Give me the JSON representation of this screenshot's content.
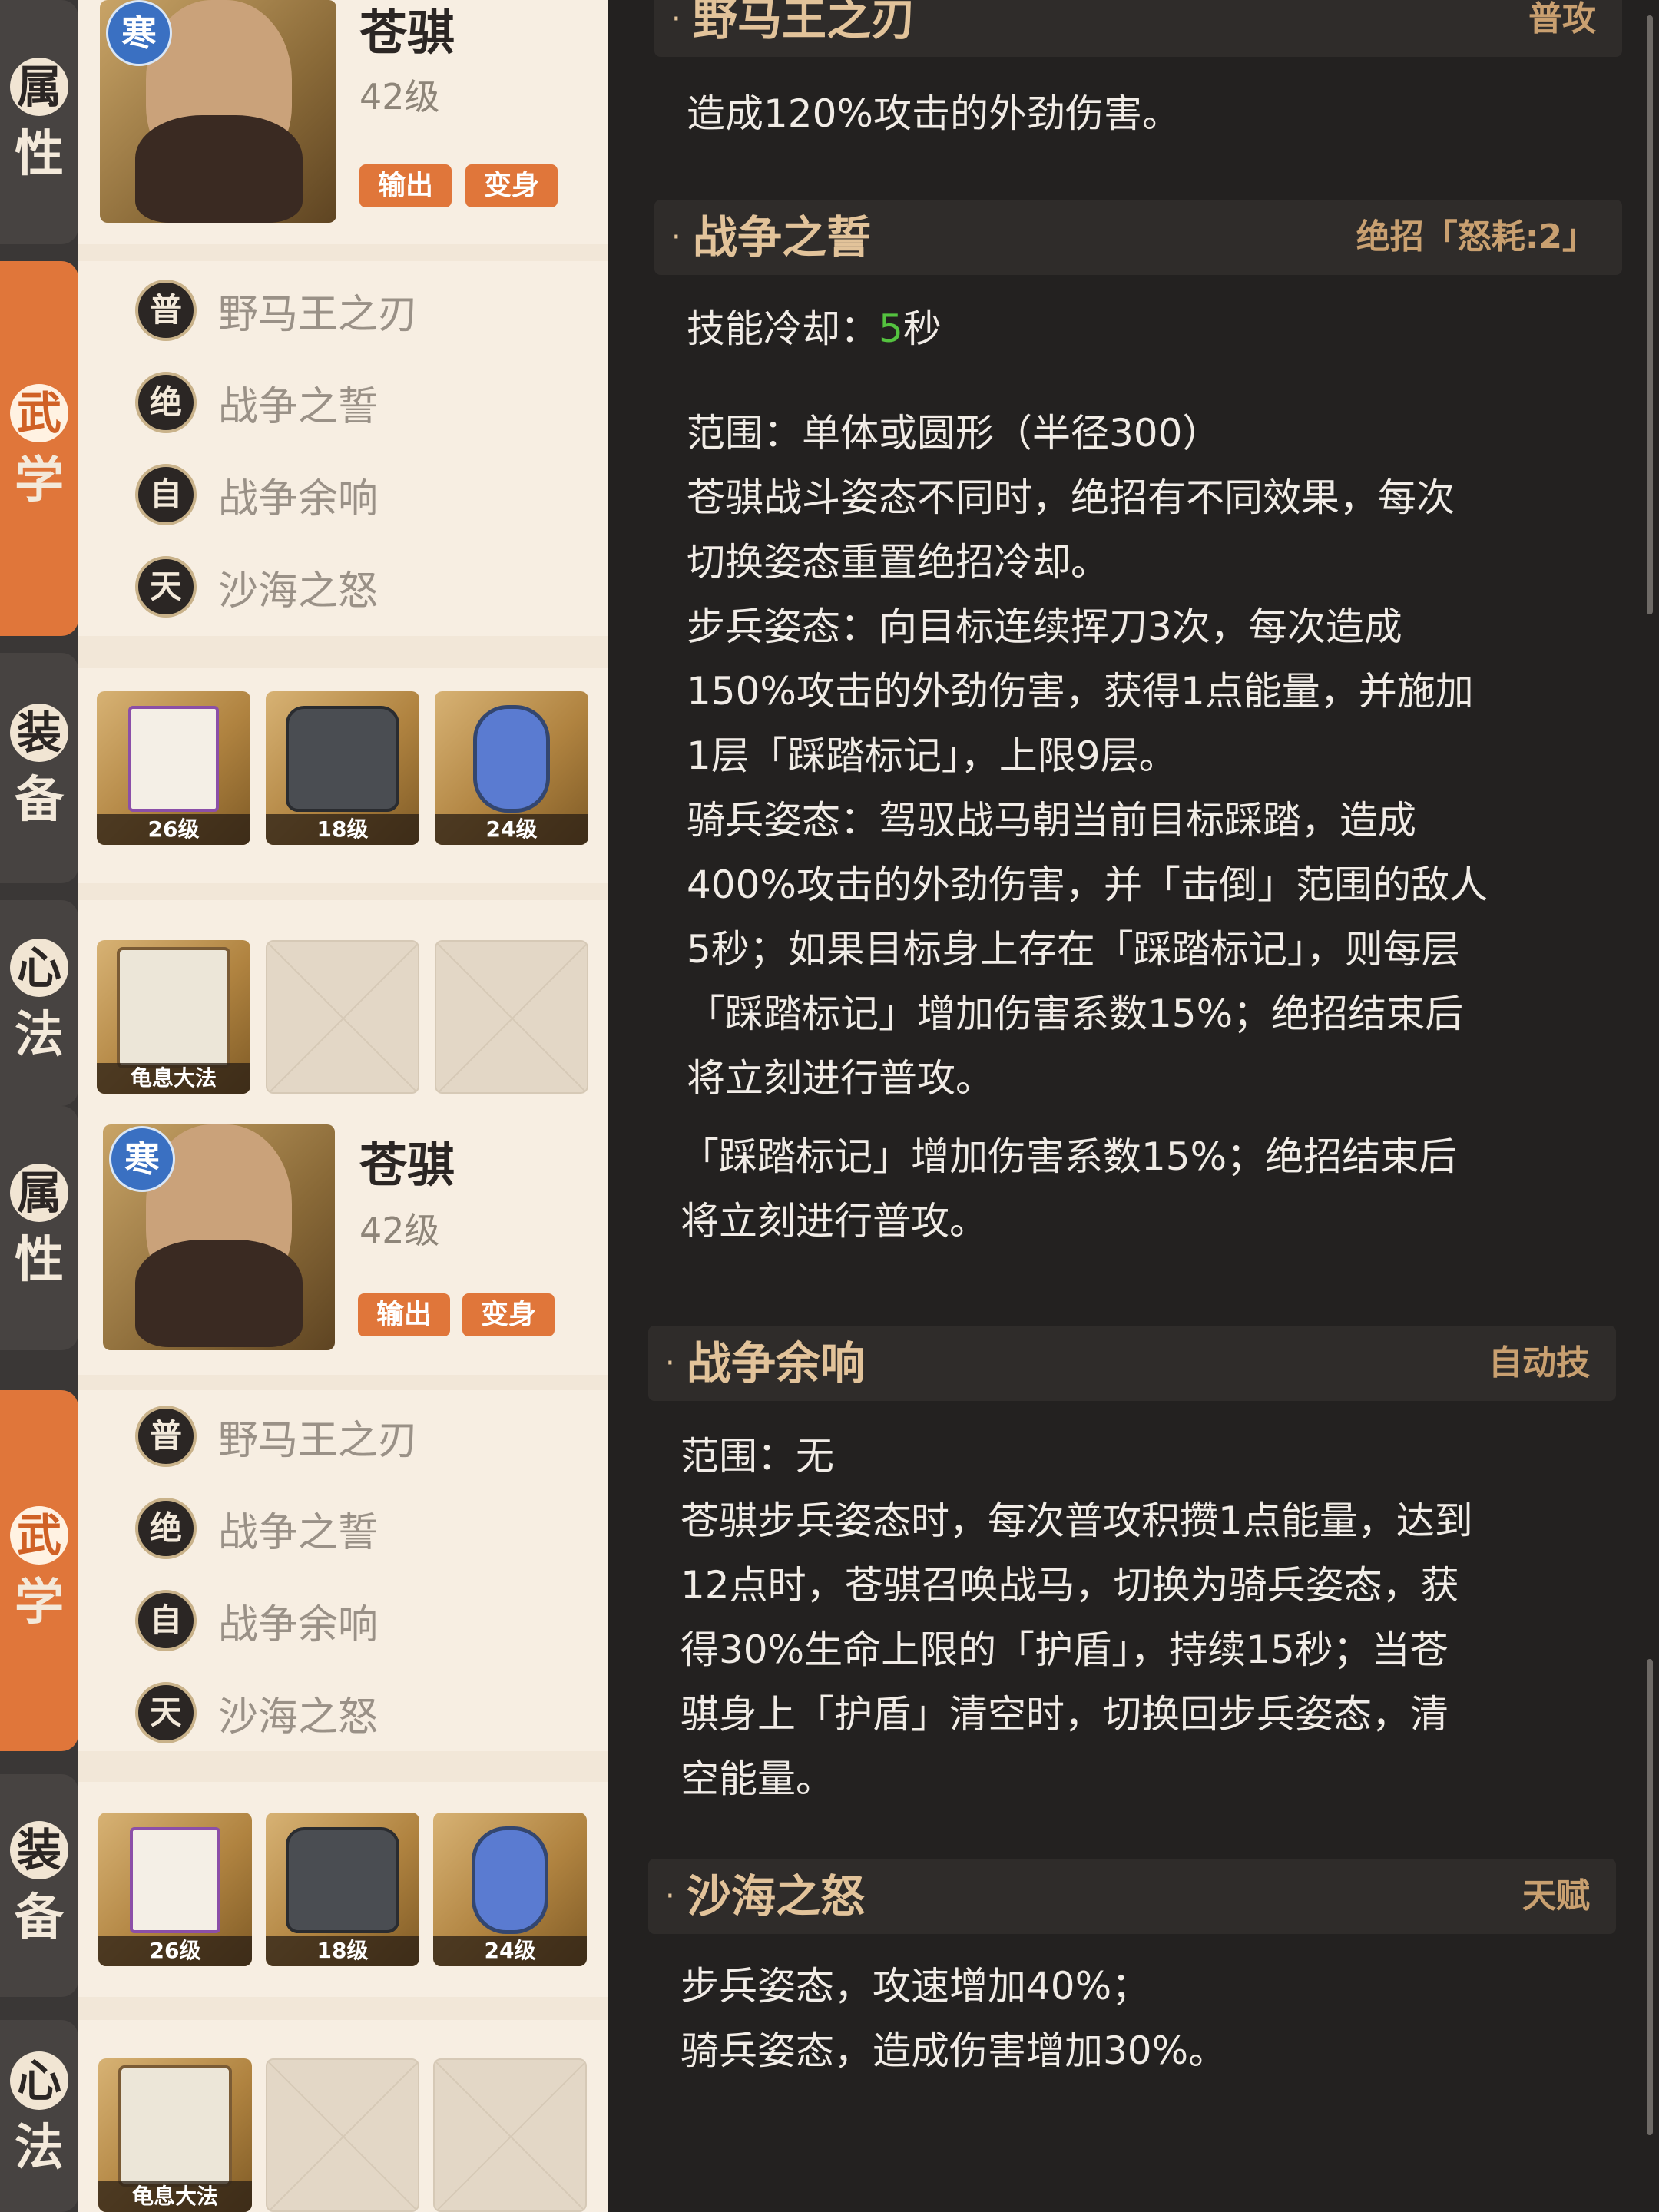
{
  "tabs": {
    "attr_1": "属",
    "attr_2": "性",
    "martial_1": "武",
    "martial_2": "学",
    "equip_1": "装",
    "equip_2": "备",
    "heart_1": "心",
    "heart_2": "法"
  },
  "hero": {
    "badge": "寒",
    "name": "苍骐",
    "level": "42级",
    "tag_output": "输出",
    "tag_transform": "变身"
  },
  "skills": [
    {
      "type": "普",
      "name": "野马王之刃"
    },
    {
      "type": "绝",
      "name": "战争之誓"
    },
    {
      "type": "自",
      "name": "战争余响"
    },
    {
      "type": "天",
      "name": "沙海之怒"
    }
  ],
  "equipment": [
    {
      "level": "26级"
    },
    {
      "level": "18级"
    },
    {
      "level": "24级"
    }
  ],
  "heart_method": {
    "name": "龟息大法"
  },
  "details_top": {
    "sec1_title": "野马王之刃",
    "sec1_type": "普攻",
    "sec1_desc": "造成120%攻击的外劲伤害。",
    "sec2_title": "战争之誓",
    "sec2_type": "绝招「怒耗:2」",
    "cooldown_label": "技能冷却：",
    "cooldown_value": "5",
    "cooldown_unit": "秒",
    "desc2_lines": [
      "范围：单体或圆形（半径300）",
      "苍骐战斗姿态不同时，绝招有不同效果，每次",
      "切换姿态重置绝招冷却。",
      "步兵姿态：向目标连续挥刀3次，每次造成",
      "150%攻击的外劲伤害，获得1点能量，并施加",
      "1层「踩踏标记」，上限9层。",
      "骑兵姿态：驾驭战马朝当前目标踩踏，造成",
      "400%攻击的外劲伤害，并「击倒」范围的敌人",
      "5秒；如果目标身上存在「踩踏标记」，则每层",
      "「踩踏标记」增加伤害系数15%；绝招结束后",
      "将立刻进行普攻。"
    ]
  },
  "details_bottom": {
    "cont_lines": [
      "「踩踏标记」增加伤害系数15%；绝招结束后",
      "将立刻进行普攻。"
    ],
    "sec3_title": "战争余响",
    "sec3_type": "自动技",
    "desc3_lines": [
      "范围：无",
      "苍骐步兵姿态时，每次普攻积攒1点能量，达到",
      "12点时，苍骐召唤战马，切换为骑兵姿态，获",
      "得30%生命上限的「护盾」，持续15秒；当苍",
      "骐身上「护盾」清空时，切换回步兵姿态，清",
      "空能量。"
    ],
    "sec4_title": "沙海之怒",
    "sec4_type": "天赋",
    "desc4_lines": [
      "步兵姿态，攻速增加40%；",
      "骑兵姿态，造成伤害增加30%。"
    ]
  }
}
